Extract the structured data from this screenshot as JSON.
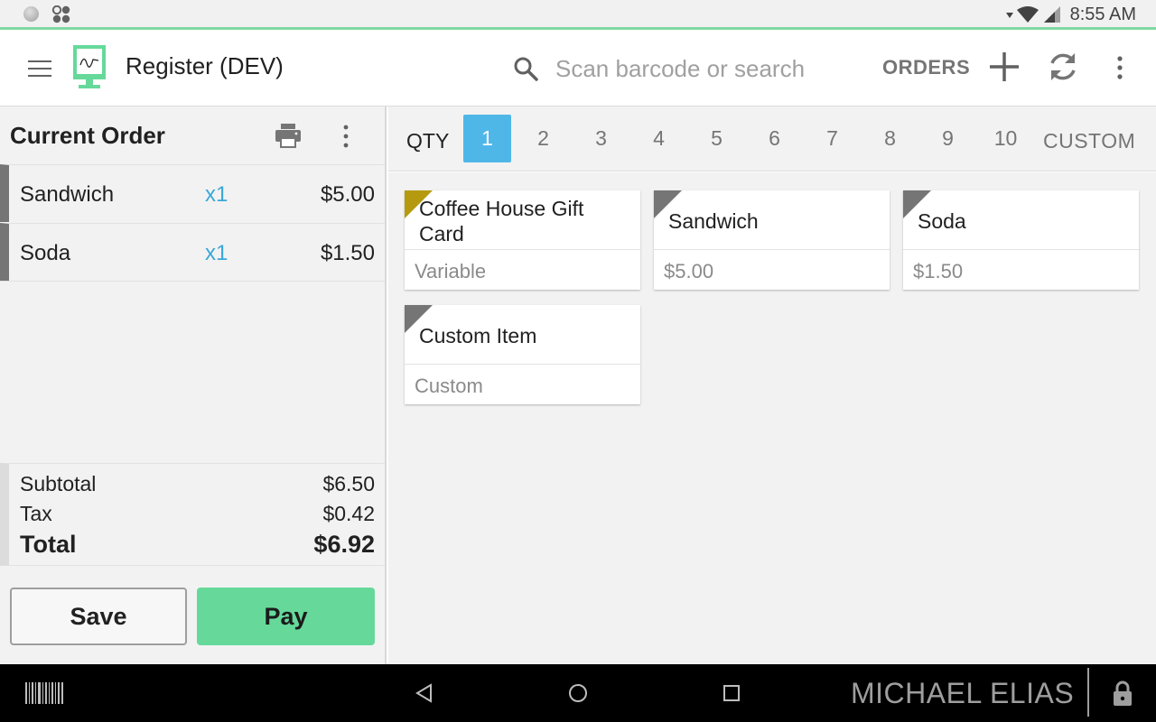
{
  "status_bar": {
    "time": "8:55 AM"
  },
  "app_bar": {
    "title": "Register (DEV)",
    "search_placeholder": "Scan barcode or search",
    "orders_label": "ORDERS"
  },
  "order": {
    "title": "Current Order",
    "lines": [
      {
        "name": "Sandwich",
        "qty": "x1",
        "price": "$5.00"
      },
      {
        "name": "Soda",
        "qty": "x1",
        "price": "$1.50"
      }
    ],
    "subtotal_label": "Subtotal",
    "subtotal": "$6.50",
    "tax_label": "Tax",
    "tax": "$0.42",
    "total_label": "Total",
    "total": "$6.92",
    "save_label": "Save",
    "pay_label": "Pay"
  },
  "qty_bar": {
    "label": "QTY",
    "options": [
      "1",
      "2",
      "3",
      "4",
      "5",
      "6",
      "7",
      "8",
      "9",
      "10"
    ],
    "selected": "1",
    "custom_label": "CUSTOM"
  },
  "items": [
    {
      "name": "Coffee House Gift Card",
      "price": "Variable",
      "corner_color": "#b59a0f"
    },
    {
      "name": "Sandwich",
      "price": "$5.00",
      "corner_color": "#757575"
    },
    {
      "name": "Soda",
      "price": "$1.50",
      "corner_color": "#757575"
    },
    {
      "name": "Custom Item",
      "price": "Custom",
      "corner_color": "#757575"
    }
  ],
  "nav_bar": {
    "user_name": "MICHAEL ELIAS"
  },
  "colors": {
    "accent_green": "#66d99a",
    "accent_blue": "#4fb7e8",
    "qty_text": "#3aa7d8"
  }
}
